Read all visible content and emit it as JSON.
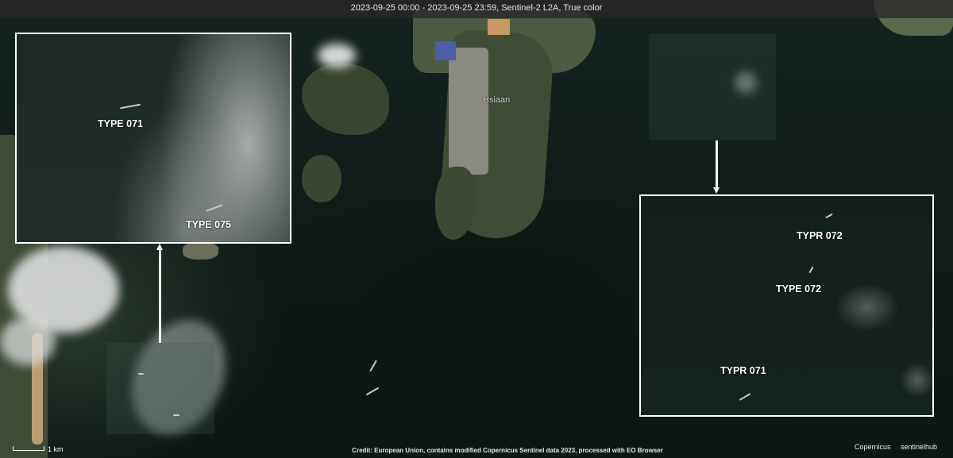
{
  "header": {
    "title": "2023-09-25 00:00 - 2023-09-25 23:59, Sentinel-2 L2A, True color"
  },
  "map": {
    "place_label": "Hsiaan"
  },
  "inset_left": {
    "labels": [
      "TYPE 071",
      "TYPE 075"
    ]
  },
  "inset_right": {
    "labels": [
      "TYPR 072",
      "TYPE 072",
      "TYPR 071"
    ]
  },
  "footer": {
    "credit": "Credit: European Union, contains modified Copernicus Sentinel data 2023, processed with EO Browser",
    "scale": "1 km",
    "logo_copernicus": "Copernicus",
    "logo_sentinelhub": "sentinelhub"
  },
  "colors": {
    "sea": "#0f1c18",
    "land": "#3a4a33",
    "annotation": "#ffffff"
  }
}
